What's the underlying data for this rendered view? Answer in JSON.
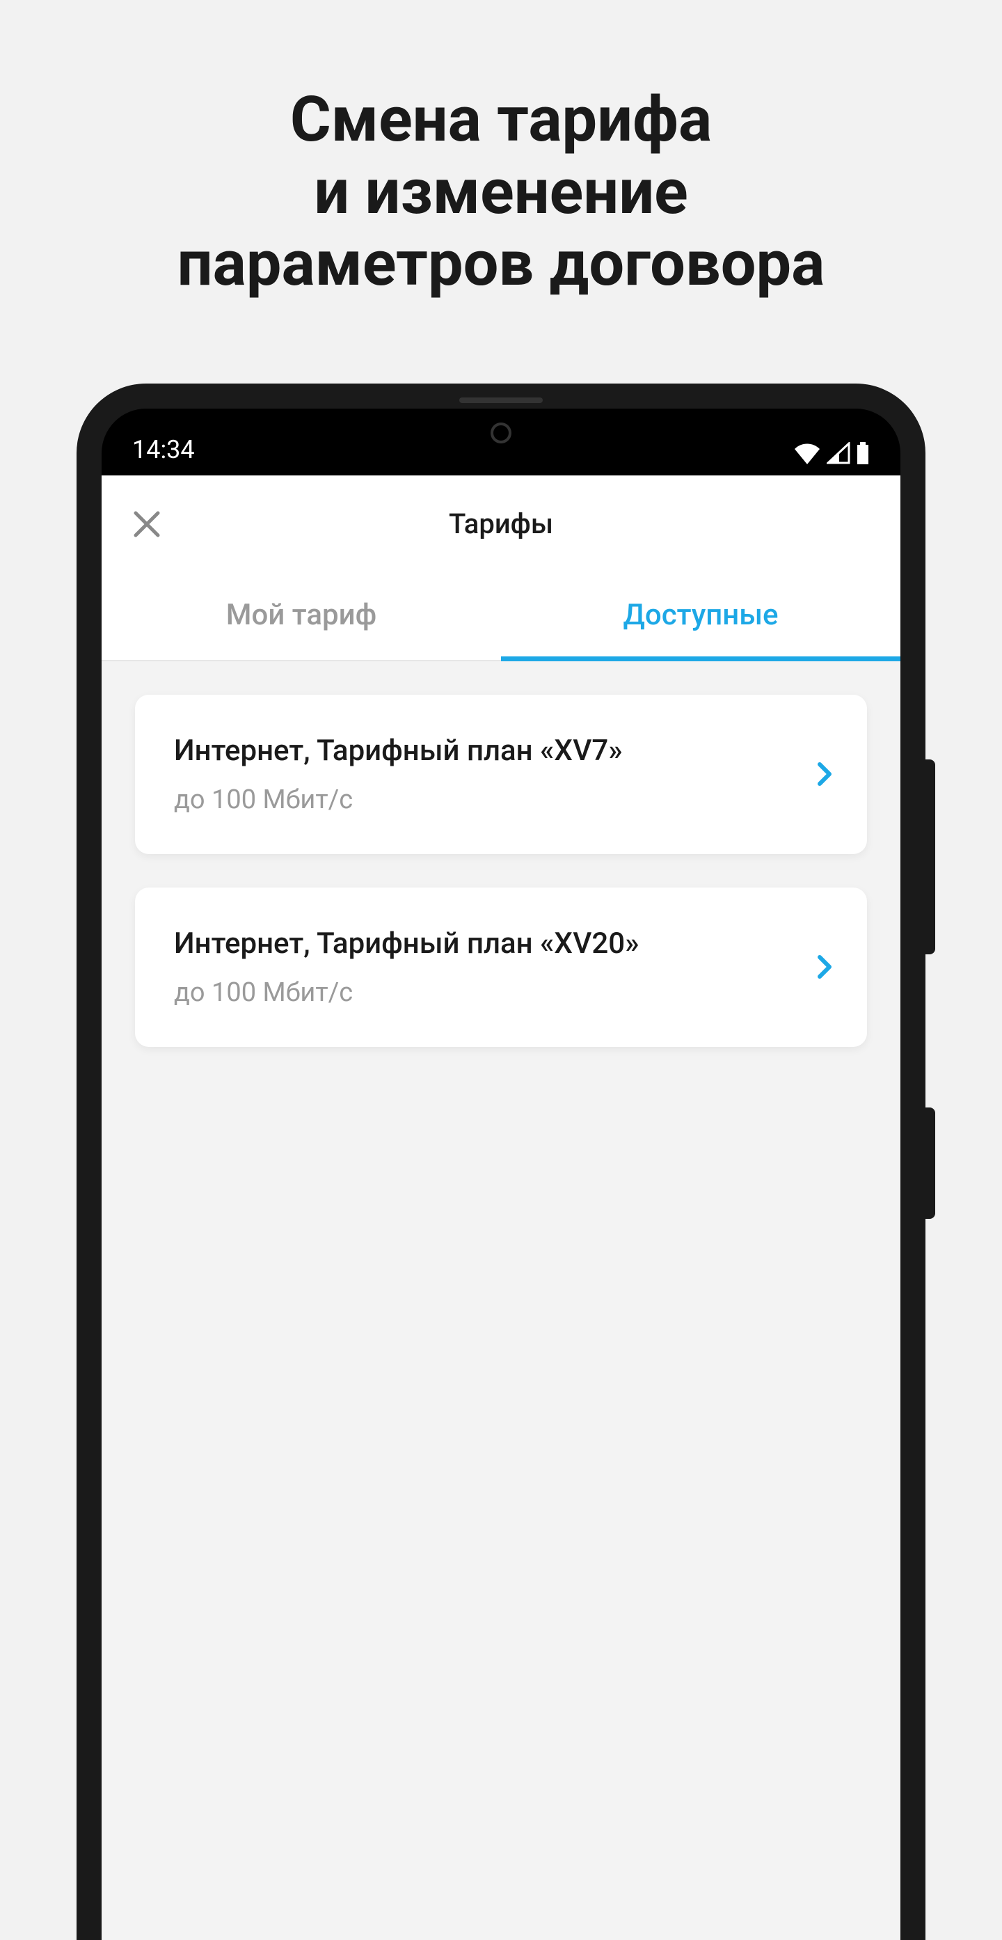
{
  "promo": {
    "title": "Смена тарифа\nи изменение\nпараметров договора"
  },
  "status_bar": {
    "time": "14:34"
  },
  "header": {
    "title": "Тарифы"
  },
  "tabs": {
    "my_tariff": "Мой тариф",
    "available": "Доступные",
    "active_index": 1
  },
  "cards": [
    {
      "title": "Интернет, Тарифный план «XV7»",
      "subtitle": "до 100 Мбит/с"
    },
    {
      "title": "Интернет, Тарифный план «XV20»",
      "subtitle": "до 100 Мбит/с"
    }
  ],
  "colors": {
    "accent": "#1da8e6",
    "muted": "#9a9a9a"
  }
}
